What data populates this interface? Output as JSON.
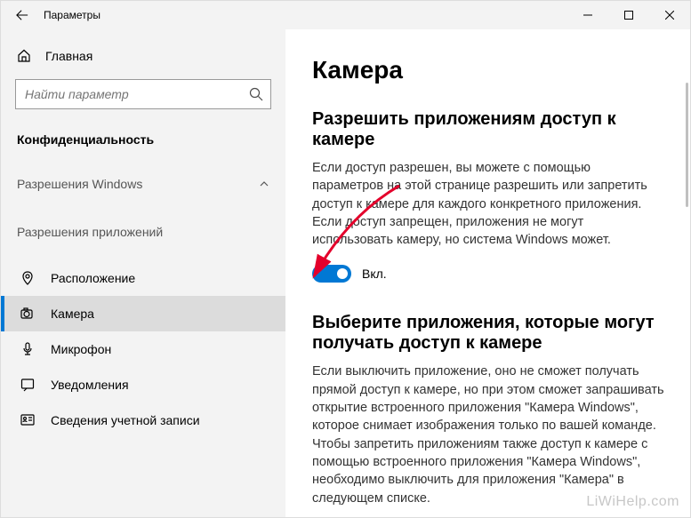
{
  "window": {
    "title": "Параметры"
  },
  "sidebar": {
    "home": "Главная",
    "search_placeholder": "Найти параметр",
    "category": "Конфиденциальность",
    "group1": "Разрешения Windows",
    "group2": "Разрешения приложений",
    "items": [
      {
        "label": "Расположение"
      },
      {
        "label": "Камера"
      },
      {
        "label": "Микрофон"
      },
      {
        "label": "Уведомления"
      },
      {
        "label": "Сведения учетной записи"
      }
    ]
  },
  "main": {
    "title": "Камера",
    "section1": {
      "heading": "Разрешить приложениям доступ к камере",
      "desc": "Если доступ разрешен, вы можете с помощью параметров на этой странице разрешить или запретить доступ к камере для каждого конкретного приложения. Если доступ запрещен, приложения не могут использовать камеру, но система Windows может.",
      "toggle_label": "Вкл."
    },
    "section2": {
      "heading": "Выберите приложения, которые могут получать доступ к камере",
      "desc": "Если выключить приложение, оно не сможет получать прямой доступ к камере, но при этом сможет запрашивать открытие встроенного приложения \"Камера Windows\", которое снимает изображения только по вашей команде. Чтобы запретить приложениям также доступ к камере с помощью встроенного приложения \"Камера Windows\", необходимо выключить для приложения \"Камера\" в следующем списке."
    }
  },
  "watermark": "LiWiHelp.com"
}
